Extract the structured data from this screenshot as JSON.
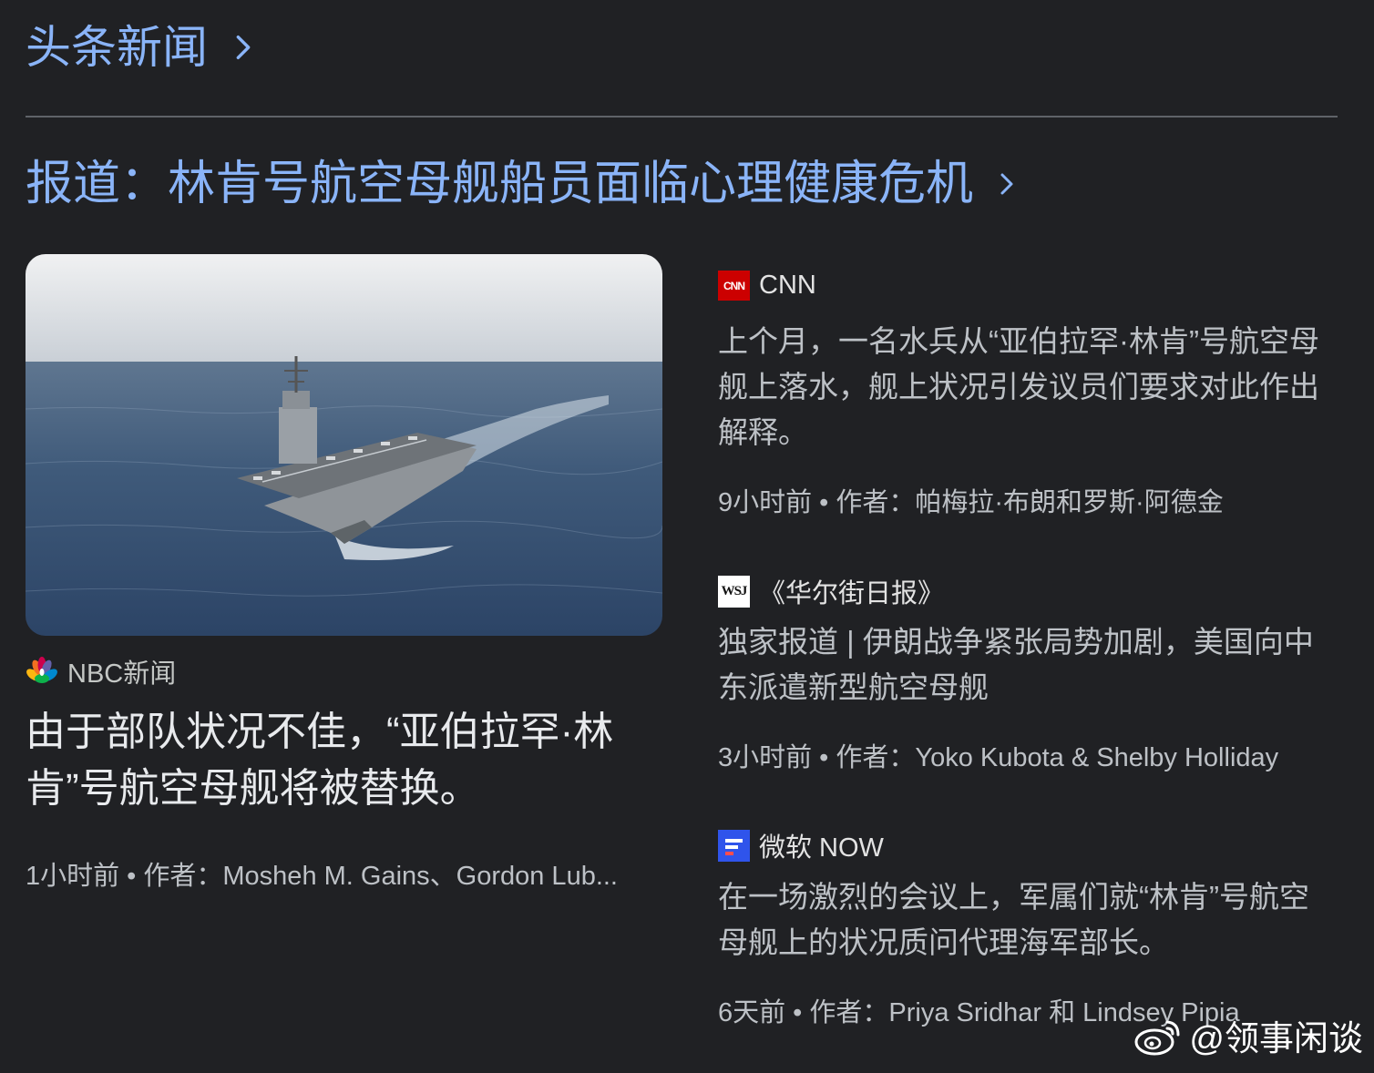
{
  "header": {
    "title": "头条新闻"
  },
  "story": {
    "title": "报道：林肯号航空母舰船员面临心理健康危机"
  },
  "main_article": {
    "source": "NBC新闻",
    "headline": "由于部队状况不佳，“亚伯拉罕·林肯”号航空母舰将被替换。",
    "meta": "1小时前 • 作者：Mosheh M. Gains、Gordon Lub..."
  },
  "side_articles": [
    {
      "source": "CNN",
      "logo_text": "CNN",
      "headline": "上个月，一名水兵从“亚伯拉罕·林肯”号航空母舰上落水，舰上状况引发议员们要求对此作出解释。",
      "meta": "9小时前 • 作者：帕梅拉·布朗和罗斯·阿德金"
    },
    {
      "source": "《华尔街日报》",
      "logo_text": "WSJ",
      "headline": "独家报道 | 伊朗战争紧张局势加剧，美国向中东派遣新型航空母舰",
      "meta": "3小时前 • 作者：Yoko Kubota & Shelby Holliday"
    },
    {
      "source": "微软 NOW",
      "headline": "在一场激烈的会议上，军属们就“林肯”号航空母舰上的状况质问代理海军部长。",
      "meta": "6天前 • 作者：Priya Sridhar 和 Lindsey Pipia"
    }
  ],
  "watermark": {
    "text": "@领事闲谈"
  },
  "colors": {
    "background": "#202124",
    "link": "#8ab4f8",
    "cnn_red": "#cc0000",
    "msn_blue": "#2f54eb"
  }
}
